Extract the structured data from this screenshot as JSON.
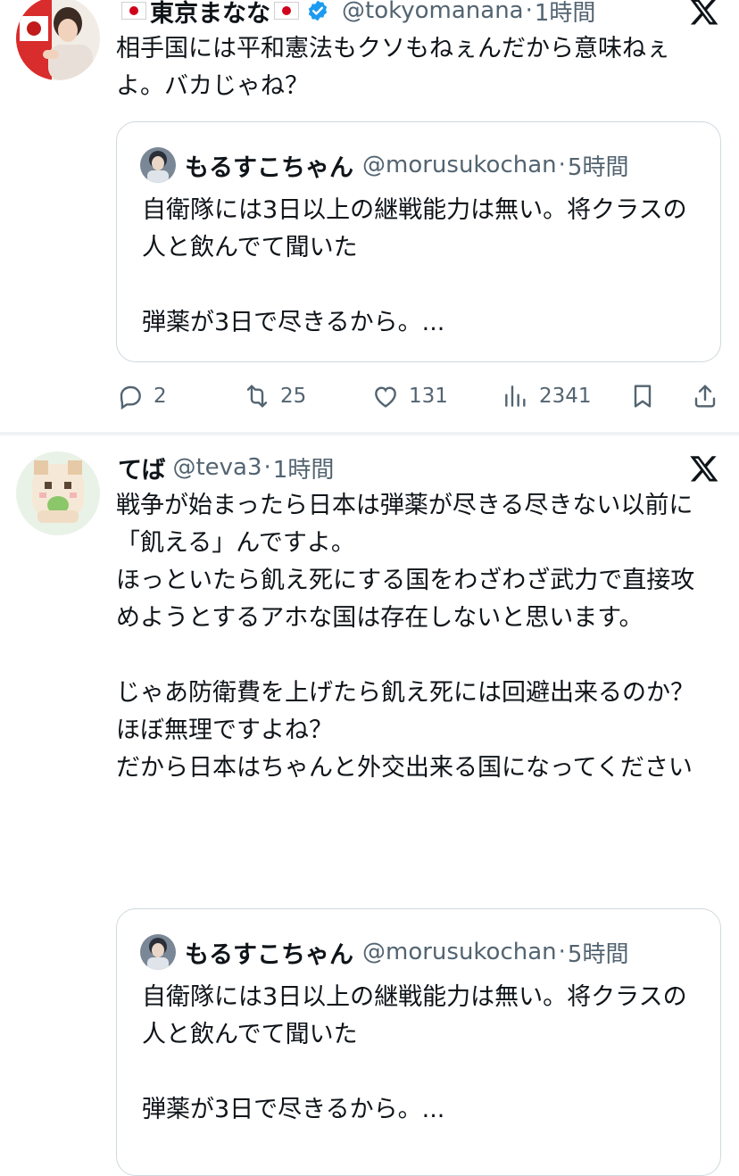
{
  "tweets": [
    {
      "display_name": "東京まなな",
      "handle": "@tokyomanana",
      "separator": "·",
      "time": "1時間",
      "text": "相手国には平和憲法もクソもねぇんだから意味ねぇよ。バカじゃね？",
      "quote": {
        "display_name": "もるすこちゃん",
        "handle": "@morusukochan",
        "separator": "·",
        "time": "5時間",
        "text": "自衛隊には3日以上の継戦能力は無い。将クラスの人と飲んでて聞いた\n\n弾薬が3日で尽きるから。..."
      },
      "actions": {
        "replies": "2",
        "retweets": "25",
        "likes": "131",
        "views": "2341"
      }
    },
    {
      "display_name": "てば",
      "handle": "@teva3",
      "separator": "·",
      "time": "1時間",
      "text": "戦争が始まったら日本は弾薬が尽きる尽きない以前に「飢える」んですよ。\nほっといたら飢え死にする国をわざわざ武力で直接攻めようとするアホな国は存在しないと思います。\n\nじゃあ防衛費を上げたら飢え死には回避出来るのか？\nほぼ無理ですよね？\nだから日本はちゃんと外交出来る国になってください",
      "quote": {
        "display_name": "もるすこちゃん",
        "handle": "@morusukochan",
        "separator": "·",
        "time": "5時間",
        "text": "自衛隊には3日以上の継戦能力は無い。将クラスの人と飲んでて聞いた\n\n弾薬が3日で尽きるから。..."
      }
    }
  ],
  "colors": {
    "text": "#0f1419",
    "muted": "#536471",
    "border": "#cfd9de",
    "verified": "#1d9bf0",
    "flag_red": "#d0021b"
  },
  "icons": {
    "reply": "reply-icon",
    "retweet": "retweet-icon",
    "like": "heart-icon",
    "views": "views-icon",
    "bookmark": "bookmark-icon",
    "share": "share-icon",
    "x_logo": "x-logo-icon",
    "verified": "verified-badge-icon"
  }
}
